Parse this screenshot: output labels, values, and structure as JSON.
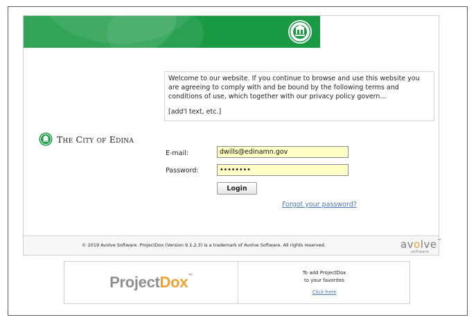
{
  "banner": {
    "seal_icon": "city-seal-icon"
  },
  "terms": {
    "paragraph": "Welcome to our website. If you continue to browse and use this website you are agreeing to comply with and be bound by the following terms and conditions of use, which together with our privacy policy govern...",
    "addl": "[add'l text, etc.]"
  },
  "city": {
    "name": "The City of Edina"
  },
  "login": {
    "email_label": "E-mail:",
    "email_value": "dwills@edinamn.gov",
    "password_label": "Password:",
    "password_value": "dwpass12",
    "button_label": "Login",
    "forgot_link": "Forgot your password?"
  },
  "footer": {
    "copyright": "© 2019 Avolve Software. ProjectDox (Version 9.1.2.3) is a trademark of Avolve Software. All rights reserved.",
    "avolve_a": "a",
    "avolve_v": "v",
    "avolve_o": "o",
    "avolve_l": "l",
    "avolve_v2": "v",
    "avolve_e": "e",
    "avolve_tm": "™",
    "avolve_sub": "software"
  },
  "bottom": {
    "logo_main": "Project",
    "logo_accent": "Dox",
    "logo_tm": "™",
    "fav_line1": "To add ProjectDox",
    "fav_line2": "to your favorites",
    "fav_link": "Click here"
  },
  "colors": {
    "brand_green": "#1a9a45",
    "input_bg": "#ffffc6",
    "link": "#4b77b8",
    "accent": "#f1a133"
  }
}
